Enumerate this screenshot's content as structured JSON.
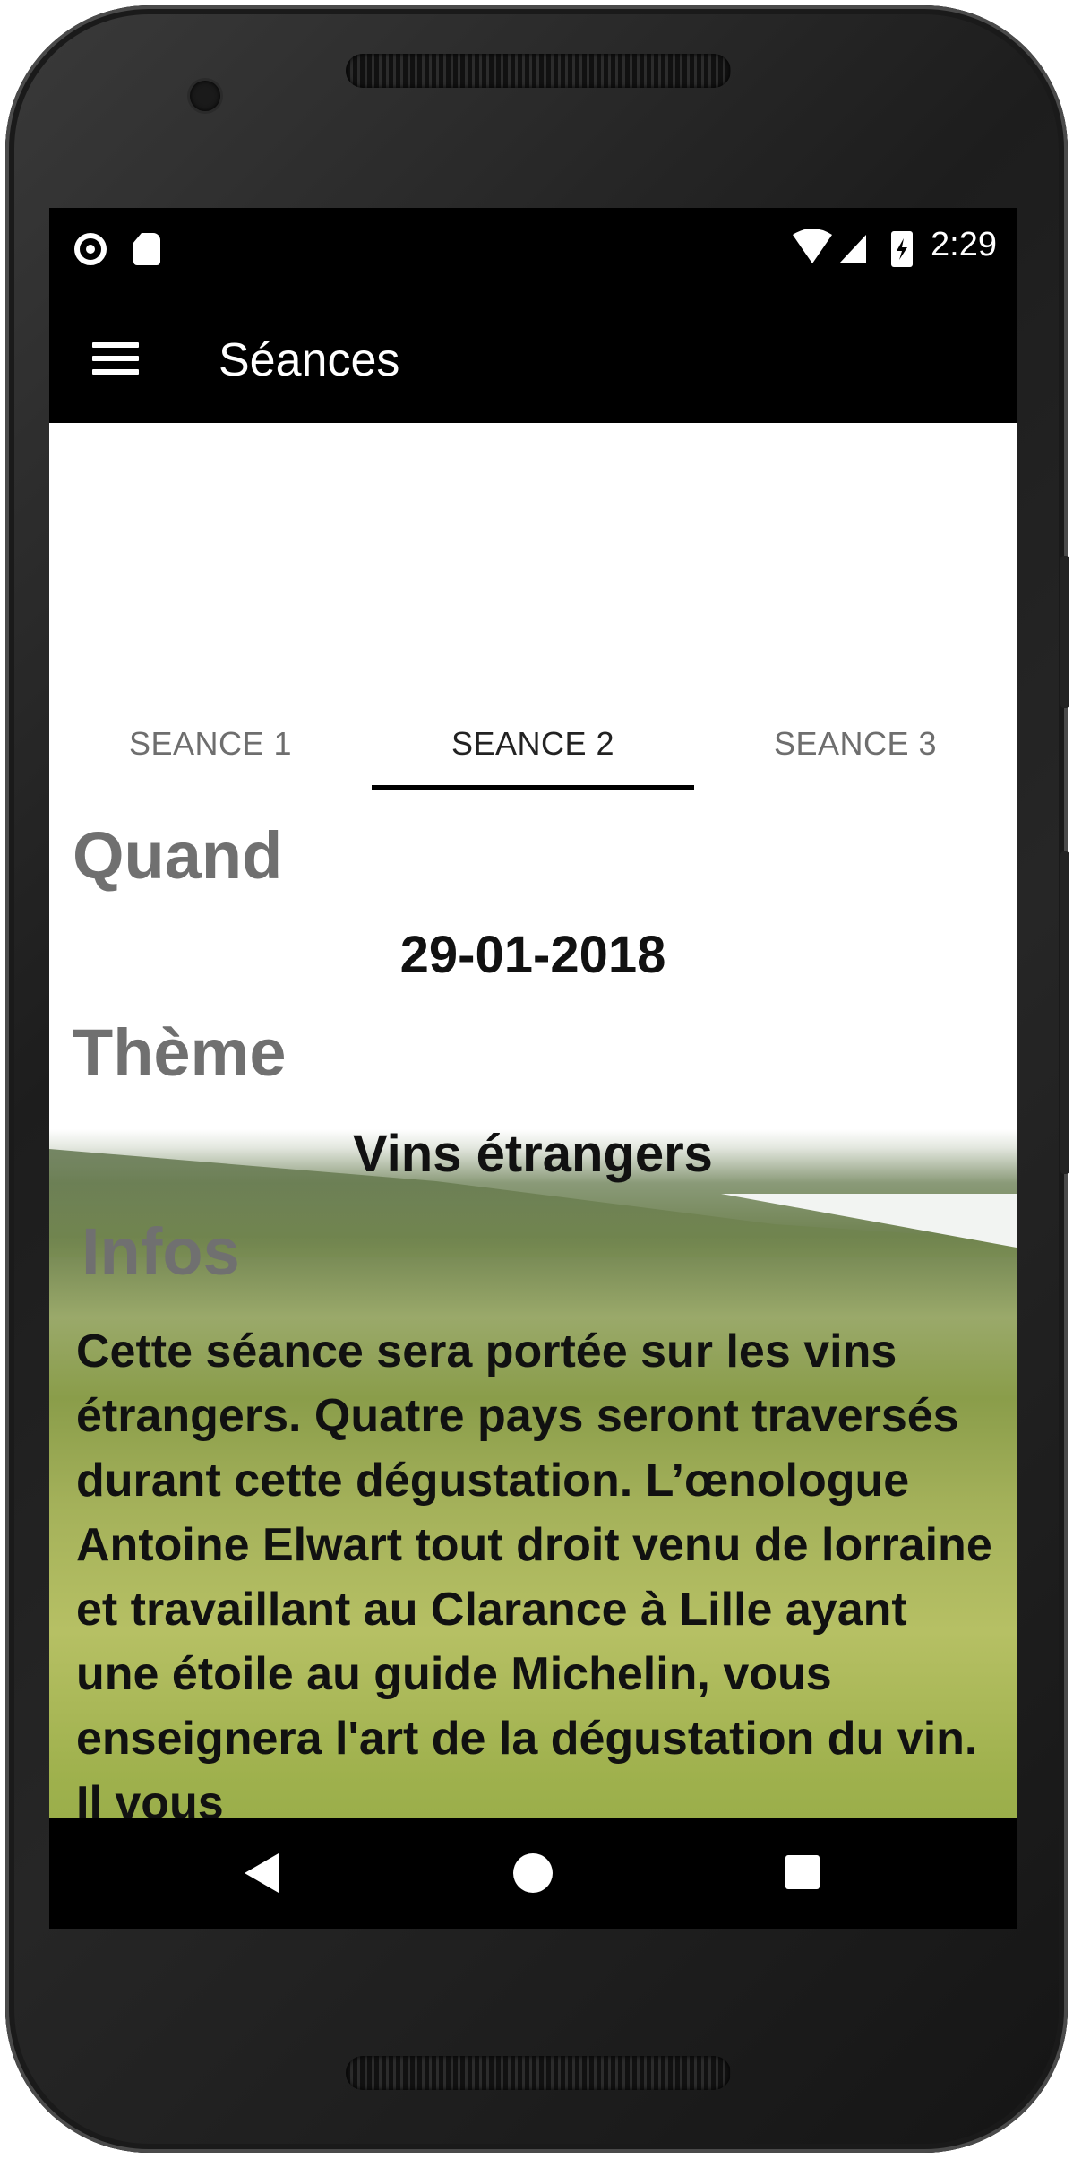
{
  "status_bar": {
    "time": "2:29"
  },
  "toolbar": {
    "title": "Séances"
  },
  "tabs": [
    {
      "label": "SEANCE 1"
    },
    {
      "label": "SEANCE 2"
    },
    {
      "label": "SEANCE 3"
    }
  ],
  "active_tab": 1,
  "session": {
    "when_label": "Quand",
    "date": "29-01-2018",
    "theme_label": "Thème",
    "theme": "Vins étrangers",
    "infos_label": "Infos",
    "infos_text": "Cette séance sera portée sur les vins étrangers. Quatre pays seront traversés durant cette dégustation. L’œnologue Antoine Elwart tout droit venu de lorraine et travaillant au Clarance à Lille ayant une étoile au guide Michelin, vous enseignera l'art de la dégustation du vin. Il vous"
  },
  "colors": {
    "bar": "#000000",
    "label_gray": "#707070",
    "tab_inactive": "#6e6e6e"
  }
}
